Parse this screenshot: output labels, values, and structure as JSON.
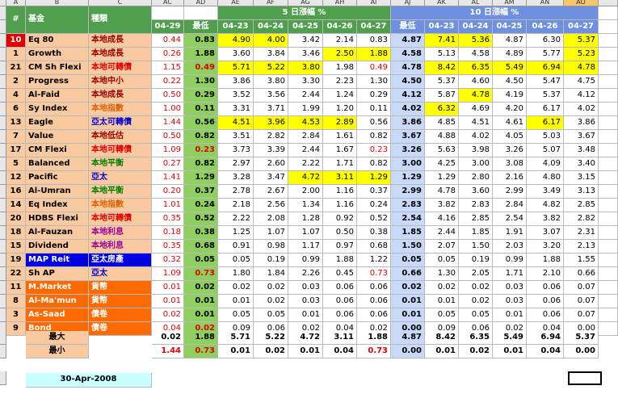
{
  "colors": {
    "green_head": "#4f9f4f",
    "blue_head": "#6f8fdf",
    "idx_red": "#e0e0e0"
  },
  "col_letters": [
    "A",
    "B",
    "C",
    "AC",
    "AD",
    "AE",
    "AF",
    "AG",
    "AH",
    "AI",
    "AJ",
    "AK",
    "AL",
    "AM",
    "AN",
    "AO"
  ],
  "header": {
    "num": "#",
    "fund": "基金",
    "type": "種類",
    "group5": "5 日漲幅 %",
    "group10": "10 日漲幅 %",
    "cols": [
      "04-29",
      "最低",
      "04-23",
      "04-24",
      "04-25",
      "04-26",
      "04-27",
      "最低",
      "04-23",
      "04-24",
      "04-25",
      "04-26",
      "04-27"
    ]
  },
  "rows": [
    {
      "n": "10",
      "name": "Eq 80",
      "type": "本地成長",
      "v": [
        "0.44",
        "0.83",
        "4.90",
        "4.00",
        "3.42",
        "2.14",
        "0.83",
        "4.87",
        "7.41",
        "5.36",
        "4.87",
        "6.30",
        "5.37"
      ]
    },
    {
      "n": "1",
      "name": "Growth",
      "type": "本地成長",
      "v": [
        "0.26",
        "1.88",
        "3.60",
        "3.84",
        "3.46",
        "2.50",
        "1.88",
        "4.58",
        "5.13",
        "4.58",
        "4.89",
        "5.77",
        "5.23"
      ]
    },
    {
      "n": "21",
      "name": "CM Sh Flexi",
      "type": "本地可轉債",
      "v": [
        "1.15",
        "0.49",
        "5.71",
        "5.22",
        "3.80",
        "1.98",
        "0.49",
        "4.78",
        "8.42",
        "6.35",
        "5.49",
        "6.94",
        "4.78"
      ]
    },
    {
      "n": "2",
      "name": "Progress",
      "type": "本地中小",
      "v": [
        "0.22",
        "1.30",
        "3.86",
        "3.80",
        "3.30",
        "2.23",
        "1.30",
        "4.50",
        "5.37",
        "4.60",
        "4.50",
        "5.47",
        "4.75"
      ]
    },
    {
      "n": "4",
      "name": "Al-Faid",
      "type": "本地成長",
      "v": [
        "0.50",
        "0.29",
        "3.52",
        "3.56",
        "2.44",
        "1.24",
        "0.29",
        "4.12",
        "5.87",
        "4.78",
        "4.19",
        "5.37",
        "4.12"
      ]
    },
    {
      "n": "6",
      "name": "Sy Index",
      "type": "本地指數",
      "v": [
        "1.00",
        "0.11",
        "3.31",
        "3.71",
        "1.99",
        "1.20",
        "0.11",
        "4.02",
        "6.32",
        "4.69",
        "4.20",
        "6.17",
        "4.02"
      ]
    },
    {
      "n": "13",
      "name": "Eagle",
      "type": "亞太可轉債",
      "v": [
        "1.44",
        "0.56",
        "4.51",
        "3.96",
        "4.53",
        "2.89",
        "0.56",
        "3.86",
        "4.85",
        "4.51",
        "4.61",
        "6.17",
        "3.86"
      ]
    },
    {
      "n": "7",
      "name": "Value",
      "type": "本地低估",
      "v": [
        "0.50",
        "0.82",
        "3.51",
        "2.82",
        "2.84",
        "1.61",
        "0.82",
        "3.67",
        "4.88",
        "4.02",
        "4.05",
        "5.03",
        "3.67"
      ]
    },
    {
      "n": "17",
      "name": "CM Flexi",
      "type": "本地可轉債",
      "v": [
        "1.09",
        "0.23",
        "3.73",
        "3.39",
        "2.44",
        "1.67",
        "0.23",
        "3.26",
        "5.63",
        "3.98",
        "3.26",
        "5.07",
        "3.48"
      ]
    },
    {
      "n": "5",
      "name": "Balanced",
      "type": "本地平衡",
      "v": [
        "0.27",
        "0.82",
        "2.97",
        "2.60",
        "2.22",
        "1.71",
        "0.82",
        "3.00",
        "4.25",
        "3.00",
        "3.08",
        "4.09",
        "3.40"
      ]
    },
    {
      "n": "12",
      "name": "Pacific",
      "type": "亞太",
      "v": [
        "1.41",
        "1.29",
        "3.28",
        "3.47",
        "4.72",
        "3.11",
        "1.29",
        "1.29",
        "1.29",
        "2.80",
        "2.16",
        "4.80",
        "3.15"
      ]
    },
    {
      "n": "16",
      "name": "Al-Umran",
      "type": "本地平衡",
      "v": [
        "0.20",
        "0.37",
        "2.78",
        "2.67",
        "2.00",
        "1.16",
        "0.37",
        "2.99",
        "4.78",
        "3.60",
        "2.99",
        "3.49",
        "3.13"
      ]
    },
    {
      "n": "14",
      "name": "Eq Index",
      "type": "本地指數",
      "v": [
        "1.01",
        "0.24",
        "2.18",
        "2.56",
        "1.34",
        "1.16",
        "0.24",
        "2.83",
        "3.82",
        "2.83",
        "2.84",
        "4.82",
        "2.85"
      ]
    },
    {
      "n": "20",
      "name": "HDBS Flexi",
      "type": "本地可轉債",
      "v": [
        "0.35",
        "0.52",
        "2.22",
        "2.08",
        "1.28",
        "0.92",
        "0.52",
        "2.54",
        "4.16",
        "2.85",
        "2.54",
        "3.82",
        "2.82"
      ]
    },
    {
      "n": "18",
      "name": "Al-Fauzan",
      "type": "本地利息",
      "v": [
        "0.18",
        "0.38",
        "1.25",
        "1.07",
        "1.07",
        "0.50",
        "0.38",
        "1.85",
        "2.44",
        "1.85",
        "1.91",
        "3.07",
        "2.31"
      ]
    },
    {
      "n": "15",
      "name": "Dividend",
      "type": "本地利息",
      "v": [
        "0.35",
        "0.68",
        "0.91",
        "0.98",
        "1.17",
        "0.97",
        "0.68",
        "1.50",
        "2.07",
        "1.50",
        "2.03",
        "3.20",
        "2.13"
      ]
    },
    {
      "n": "19",
      "name": "MAP Reit",
      "type": "亞太房產",
      "v": [
        "0.32",
        "0.05",
        "0.05",
        "0.19",
        "0.99",
        "1.88",
        "1.22",
        "0.05",
        "0.05",
        "0.19",
        "0.99",
        "1.88",
        "1.55"
      ]
    },
    {
      "n": "22",
      "name": "Sh AP",
      "type": "亞太",
      "v": [
        "1.09",
        "0.73",
        "1.80",
        "1.84",
        "2.26",
        "0.45",
        "0.73",
        "0.66",
        "1.30",
        "2.05",
        "1.71",
        "2.10",
        "0.66"
      ]
    },
    {
      "n": "11",
      "name": "M.Market",
      "type": "貨幣",
      "v": [
        "0.01",
        "0.02",
        "0.02",
        "0.02",
        "0.03",
        "0.06",
        "0.06",
        "0.02",
        "0.02",
        "0.02",
        "0.03",
        "0.06",
        "0.07"
      ]
    },
    {
      "n": "8",
      "name": "Al-Ma'mun",
      "type": "貨幣",
      "v": [
        "0.01",
        "0.01",
        "0.01",
        "0.02",
        "0.03",
        "0.06",
        "0.06",
        "0.01",
        "0.01",
        "0.02",
        "0.03",
        "0.06",
        "0.07"
      ]
    },
    {
      "n": "3",
      "name": "As-Saad",
      "type": "債卷",
      "v": [
        "0.02",
        "0.01",
        "0.05",
        "0.05",
        "0.01",
        "0.06",
        "0.06",
        "0.01",
        "0.05",
        "0.05",
        "0.01",
        "0.06",
        "0.07"
      ]
    },
    {
      "n": "9",
      "name": "Bond",
      "type": "債卷",
      "v": [
        "0.04",
        "0.02",
        "0.09",
        "0.06",
        "0.02",
        "0.04",
        "0.02",
        "0.00",
        "0.09",
        "0.06",
        "0.02",
        "0.04",
        "0.00"
      ]
    }
  ],
  "summary": {
    "max_label": "最大",
    "min_label": "最小",
    "max": [
      "0.02",
      "1.88",
      "5.71",
      "5.22",
      "4.72",
      "3.11",
      "1.88",
      "4.87",
      "8.42",
      "6.35",
      "5.49",
      "6.94",
      "5.37"
    ],
    "min": [
      "1.44",
      "0.73",
      "0.01",
      "0.02",
      "0.01",
      "0.04",
      "0.73",
      "0.00",
      "0.01",
      "0.02",
      "0.01",
      "0.04",
      "0.00"
    ]
  },
  "date": "30-Apr-2008"
}
